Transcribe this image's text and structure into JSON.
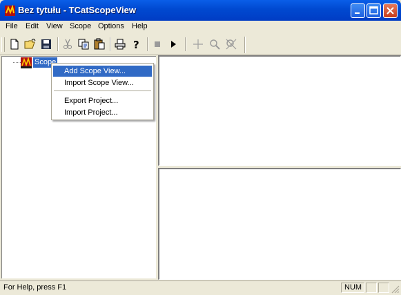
{
  "window": {
    "title": "Bez tytułu - TCatScopeView"
  },
  "menubar": {
    "items": [
      "File",
      "Edit",
      "View",
      "Scope",
      "Options",
      "Help"
    ]
  },
  "toolbar": {
    "tools": [
      "new-file-icon",
      "open-folder-icon",
      "save-icon",
      "cut-icon",
      "copy-icon",
      "paste-icon",
      "print-icon",
      "help-icon",
      "stop-icon",
      "play-icon",
      "crosshair-icon",
      "zoom-icon",
      "zoom-reset-icon"
    ]
  },
  "tree": {
    "root_label": "Scope"
  },
  "context_menu": {
    "items": [
      "Add Scope View...",
      "Import Scope  View...",
      "Export Project...",
      "Import Project..."
    ],
    "highlighted_index": 0
  },
  "statusbar": {
    "help_text": "For Help, press F1",
    "num_indicator": "NUM"
  },
  "colors": {
    "title_bar": "#0054e3",
    "selection": "#316ac5",
    "chrome": "#ece9d8"
  }
}
